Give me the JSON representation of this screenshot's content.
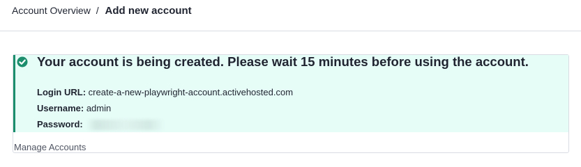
{
  "breadcrumb": {
    "parent": "Account Overview",
    "separator": "/",
    "current": "Add new account"
  },
  "alert": {
    "icon": "check-circle-icon",
    "status_color": "#1c8d6d",
    "background_color": "#e6fcf7",
    "title": "Your account is being created. Please wait 15 minutes before using the account.",
    "login_url_label": "Login URL:",
    "login_url_value": "create-a-new-playwright-account.activehosted.com",
    "username_label": "Username:",
    "username_value": "admin",
    "password_label": "Password:"
  },
  "footer": {
    "manage_accounts_label": "Manage Accounts"
  }
}
